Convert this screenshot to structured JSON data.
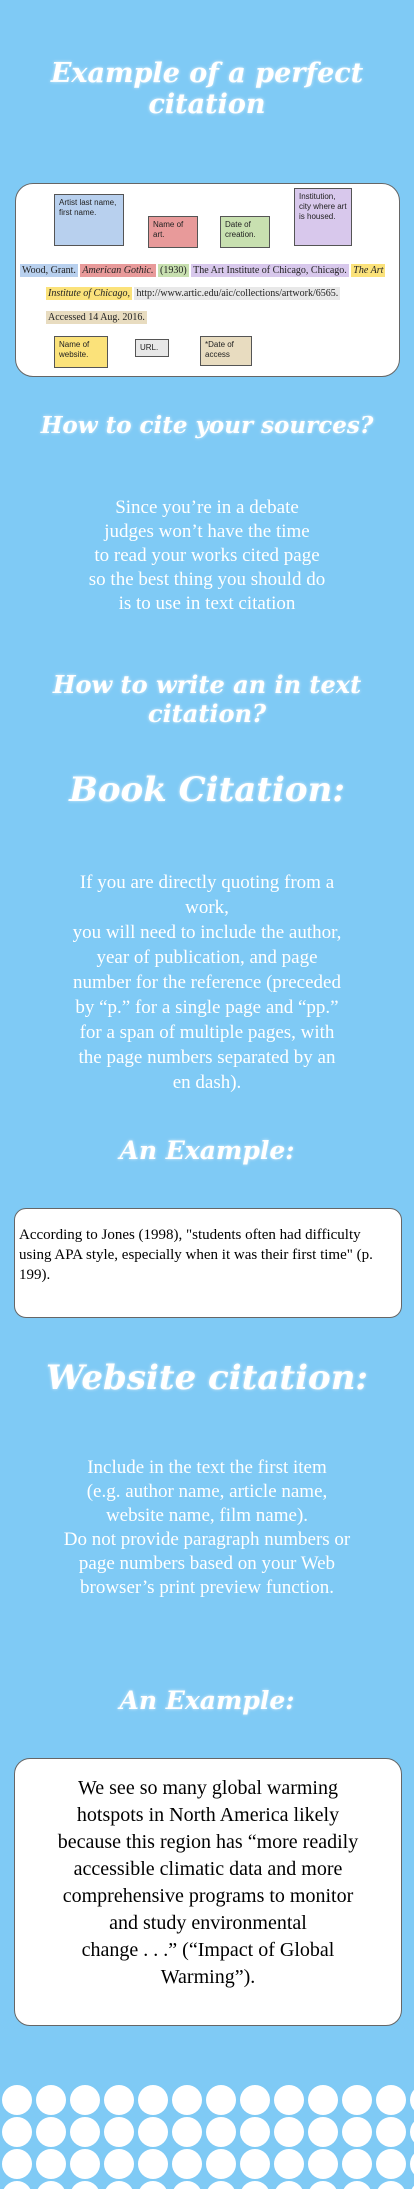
{
  "title": "Example of a perfect citation",
  "example_box": {
    "labels": {
      "artist": "Artist last name, first name.",
      "art_name": "Name of art.",
      "date": "Date of creation.",
      "institution": "Institution, city where art is housed.",
      "website": "Name of website.",
      "url": "URL.",
      "date_access": "*Date of access"
    },
    "line1": {
      "author": "Wood, Grant.",
      "title": "American Gothic.",
      "year": "(1930)",
      "institution": "The Art Institute of Chicago, Chicago.",
      "site_start": "The Art"
    },
    "line2": {
      "site_end": "Institute of Chicago,",
      "url": "http://www.artic.edu/aic/collections/artwork/6565."
    },
    "line3": "Accessed 14 Aug. 2016.",
    "colors": {
      "artist": "#b8d0ee",
      "art_name": "#e89a9a",
      "date": "#c8e0b0",
      "institution": "#d8c8ec",
      "website": "#fbe27a",
      "url": "#e8e8e8",
      "access": "#e8dcc0"
    }
  },
  "cite_sources": {
    "heading": "How to cite your sources?",
    "body": [
      "Since you’re in a  debate",
      "judges won’t have the time",
      "to read your works cited page",
      "so the best thing you should do",
      "is to use in text citation"
    ]
  },
  "in_text_heading": "How to write an in text citation?",
  "book": {
    "heading": "Book Citation:",
    "body": [
      "If you are directly quoting from a",
      "work,",
      "you will need to include the author,",
      "year of publication, and page",
      "number for the reference (preceded",
      "by “p.” for a single page and “pp.”",
      "for a span of multiple pages, with",
      "the page numbers separated by an",
      "en dash)."
    ],
    "example_heading": "An Example:",
    "example_text": "According to Jones (1998), \"students often had difficulty using APA style, especially when it was their first time\" (p. 199)."
  },
  "website": {
    "heading": "Website citation:",
    "body": [
      "Include in the text the first item",
      "(e.g. author name, article name,",
      "website name, film name).",
      "Do not provide paragraph numbers or",
      "page numbers based on your Web",
      "browser’s print preview function."
    ],
    "example_heading": "An Example:",
    "example_lines": [
      "We see so many global warming",
      "hotspots in North America likely",
      "because this region has “more readily",
      "accessible climatic data and more",
      "comprehensive programs to monitor",
      "and study environmental",
      "change . . .” (“Impact of Global",
      "Warming”)."
    ]
  }
}
